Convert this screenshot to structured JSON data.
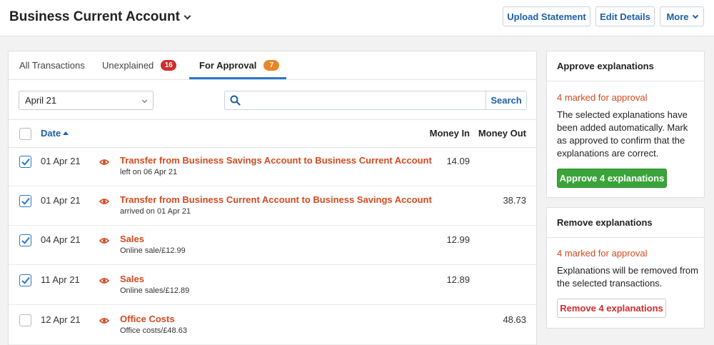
{
  "header": {
    "title": "Business Current Account",
    "upload_label": "Upload Statement",
    "edit_label": "Edit Details",
    "more_label": "More"
  },
  "tabs": [
    {
      "label": "All Transactions"
    },
    {
      "label": "Unexplained",
      "badge": "16",
      "badge_color": "#d22b2b"
    },
    {
      "label": "For Approval",
      "badge": "7",
      "badge_color": "#e8862a"
    }
  ],
  "filters": {
    "month": "April 21",
    "search_placeholder": "",
    "search_label": "Search"
  },
  "columns": {
    "date": "Date",
    "money_in": "Money In",
    "money_out": "Money Out"
  },
  "transactions": [
    {
      "checked": true,
      "date": "01 Apr 21",
      "description": "Transfer from Business Savings Account to Business Current Account",
      "detail": "left on 06 Apr 21",
      "money_in": "14.09",
      "money_out": ""
    },
    {
      "checked": true,
      "date": "01 Apr 21",
      "description": "Transfer from Business Current Account to Business Savings Account",
      "detail": "arrived on 01 Apr 21",
      "money_in": "",
      "money_out": "38.73"
    },
    {
      "checked": true,
      "date": "04 Apr 21",
      "description": "Sales",
      "detail": "Online sale/£12.99",
      "money_in": "12.99",
      "money_out": ""
    },
    {
      "checked": true,
      "date": "11 Apr 21",
      "description": "Sales",
      "detail": "Online sales/£12.89",
      "money_in": "12.89",
      "money_out": ""
    },
    {
      "checked": false,
      "date": "12 Apr 21",
      "description": "Office Costs",
      "detail": "Office costs/£48.63",
      "money_in": "",
      "money_out": "48.63"
    }
  ],
  "approve_card": {
    "title": "Approve explanations",
    "marked": "4 marked for approval",
    "text": "The selected explanations have been added automatically. Mark as approved to confirm that the explanations are correct.",
    "button": "Approve 4 explanations"
  },
  "remove_card": {
    "title": "Remove explanations",
    "marked": "4 marked for approval",
    "text": "Explanations will be removed from the selected transactions.",
    "button": "Remove 4 explanations"
  },
  "colors": {
    "accent": "#2a78c8",
    "link": "#1b5fa8",
    "description": "#d14a1f",
    "approve": "#3aa43a",
    "remove": "#d22b2b"
  }
}
